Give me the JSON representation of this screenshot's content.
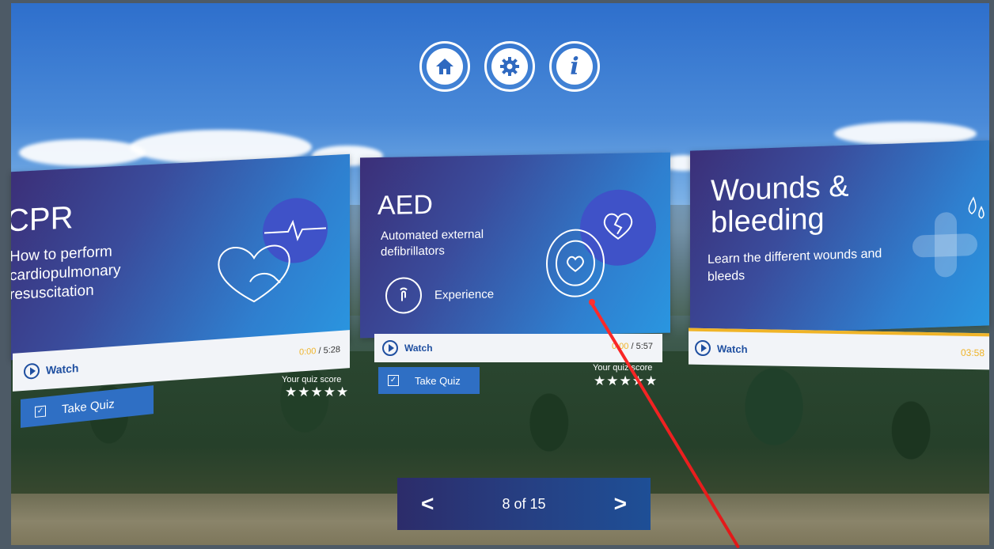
{
  "top_nav": {
    "home": "home-icon",
    "settings": "gear-icon",
    "info": "i"
  },
  "cards": [
    {
      "title": "CPR",
      "subtitle": "How to perform cardiopulmonary resuscitation",
      "watch_label": "Watch",
      "time_current": "0:00",
      "time_total": "/ 5:28",
      "quiz_label": "Take Quiz",
      "score_label": "Your quiz score",
      "stars": "★★★★★"
    },
    {
      "title": "AED",
      "subtitle": "Automated external defibrillators",
      "experience_label": "Experience",
      "watch_label": "Watch",
      "time_current": "0:00",
      "time_total": "/ 5:57",
      "quiz_label": "Take Quiz",
      "score_label": "Your quiz score",
      "stars": "★★★★★"
    },
    {
      "title": "Wounds & bleeding",
      "subtitle": "Learn the different wounds and bleeds",
      "watch_label": "Watch",
      "time_total": "03:58"
    }
  ],
  "pager": {
    "prev": "<",
    "label": "8 of 15",
    "next": ">"
  },
  "colors": {
    "accent": "#2f69c0",
    "time_highlight": "#f0b428",
    "laser": "#e01818"
  }
}
